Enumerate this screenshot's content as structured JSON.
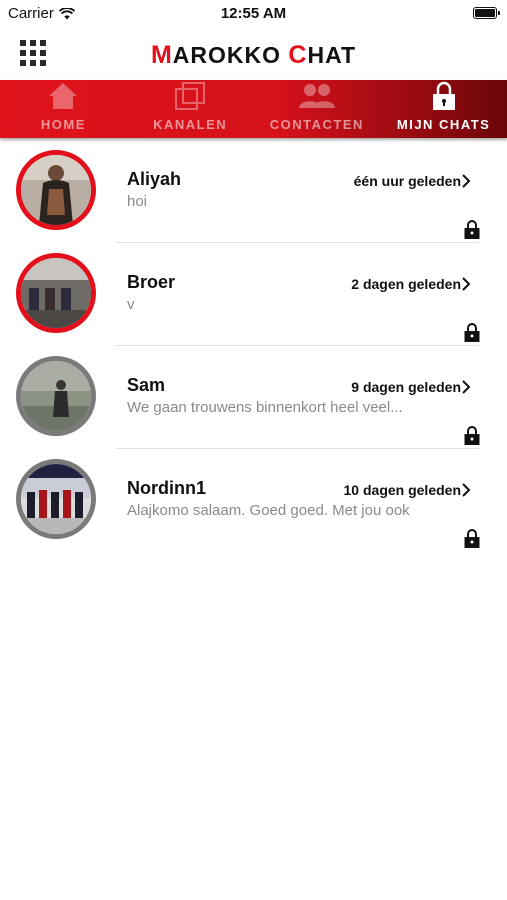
{
  "status_bar": {
    "carrier": "Carrier",
    "time": "12:55 AM"
  },
  "header": {
    "title_m": "M",
    "title_rest1": "AROKKO ",
    "title_c": "C",
    "title_rest2": "HAT"
  },
  "tabs": [
    {
      "label": "HOME",
      "icon": "home-icon",
      "active": false
    },
    {
      "label": "KANALEN",
      "icon": "channels-icon",
      "active": false
    },
    {
      "label": "CONTACTEN",
      "icon": "contacts-icon",
      "active": false
    },
    {
      "label": "MIJN CHATS",
      "icon": "lock-icon",
      "active": true
    }
  ],
  "chats": [
    {
      "name": "Aliyah",
      "preview": "hoi",
      "when": "één uur geleden"
    },
    {
      "name": "Broer",
      "preview": "v",
      "when": "2 dagen geleden"
    },
    {
      "name": "Sam",
      "preview": "We gaan trouwens binnenkort heel veel...",
      "when": "9 dagen geleden"
    },
    {
      "name": "Nordinn1",
      "preview": "Alajkomo salaam. Goed goed. Met jou ook",
      "when": "10 dagen geleden"
    }
  ],
  "colors": {
    "accent": "#e3101b",
    "tab_bar": "#d5111a",
    "muted_text": "#8a8a8a"
  }
}
